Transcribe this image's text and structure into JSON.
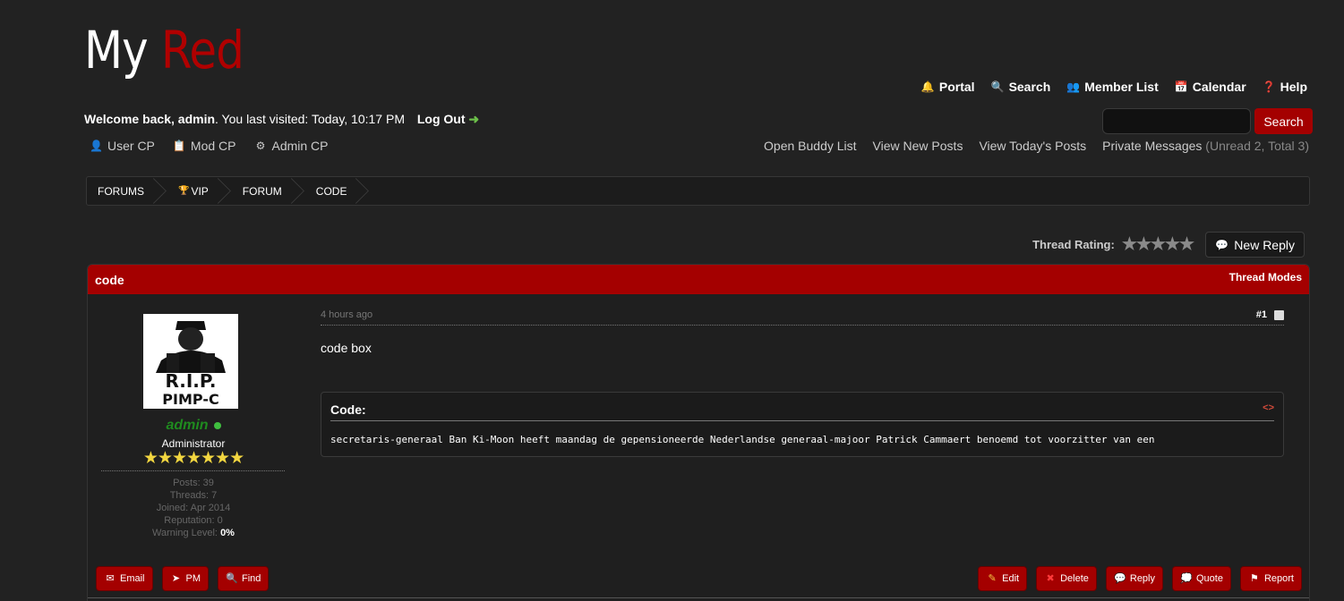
{
  "logo": {
    "part1": "My",
    "part2": "Red"
  },
  "topnav": [
    {
      "label": "Portal",
      "icon": "bell-icon",
      "glyph": "🔔"
    },
    {
      "label": "Search",
      "icon": "magnifier-icon",
      "glyph": "🔍"
    },
    {
      "label": "Member List",
      "icon": "members-icon",
      "glyph": "👥"
    },
    {
      "label": "Calendar",
      "icon": "calendar-icon",
      "glyph": "📅"
    },
    {
      "label": "Help",
      "icon": "help-icon",
      "glyph": "❓"
    }
  ],
  "welcome": {
    "prefix": "Welcome back, ",
    "username": "admin",
    "suffix": ". You last visited: Today, 10:17 PM",
    "logout": "Log Out",
    "logout_arrow": "➜"
  },
  "search": {
    "button": "Search",
    "value": ""
  },
  "cplinks": [
    {
      "label": "User CP",
      "icon": "user-cp-icon",
      "glyph": "👤"
    },
    {
      "label": "Mod CP",
      "icon": "mod-cp-icon",
      "glyph": "📋"
    },
    {
      "label": "Admin CP",
      "icon": "admin-cp-icon",
      "glyph": "⚙"
    }
  ],
  "userlinks": {
    "buddy": "Open Buddy List",
    "new_posts": "View New Posts",
    "todays_posts": "View Today's Posts",
    "pm": "Private Messages",
    "pm_counts": "(Unread 2, Total 3)"
  },
  "breadcrumb": [
    "FORUMS",
    "VIP",
    "FORUM",
    "CODE"
  ],
  "breadcrumb_vip_icon": "🏆",
  "rating": {
    "label": "Thread Rating:",
    "stars": "★★★★★",
    "value": 0,
    "max": 5
  },
  "new_reply": {
    "label": "New Reply",
    "icon": "💬"
  },
  "thread": {
    "title": "code",
    "modes": "Thread Modes"
  },
  "author": {
    "name": "admin",
    "online": true,
    "title": "Administrator",
    "stars": "★★★★★★★",
    "posts": "Posts: 39",
    "threads": "Threads: 7",
    "joined": "Joined: Apr 2014",
    "reputation": "Reputation: 0",
    "warning_label": "Warning Level: ",
    "warning_value": "0%"
  },
  "post": {
    "time": "4 hours ago",
    "number": "#1",
    "body": "code box",
    "code_label": "Code:",
    "code_icon": "<>",
    "code_text": "secretaris-generaal Ban Ki-Moon heeft maandag de gepensioneerde Nederlandse generaal-majoor Patrick Cammaert benoemd tot voorzitter van een"
  },
  "buttons_left": [
    {
      "label": "Email",
      "name": "email-button",
      "icon": "envelope-icon",
      "glyph": "✉"
    },
    {
      "label": "PM",
      "name": "pm-button",
      "icon": "paper-plane-icon",
      "glyph": "➤"
    },
    {
      "label": "Find",
      "name": "find-button",
      "icon": "magnifier-icon",
      "glyph": "🔍"
    }
  ],
  "buttons_right": [
    {
      "label": "Edit",
      "name": "edit-button",
      "icon": "pencil-icon",
      "glyph": "✎"
    },
    {
      "label": "Delete",
      "name": "delete-button",
      "icon": "cross-icon",
      "glyph": "✖"
    },
    {
      "label": "Reply",
      "name": "reply-button",
      "icon": "speech-bubble-icon",
      "glyph": "💬"
    },
    {
      "label": "Quote",
      "name": "quote-button",
      "icon": "quote-bubble-icon",
      "glyph": "💭"
    },
    {
      "label": "Report",
      "name": "report-button",
      "icon": "flag-icon",
      "glyph": "⚑"
    }
  ],
  "colors": {
    "accent": "#a40000",
    "background": "#222222",
    "username": "#1f8b1f",
    "online": "#3fbf3f"
  }
}
